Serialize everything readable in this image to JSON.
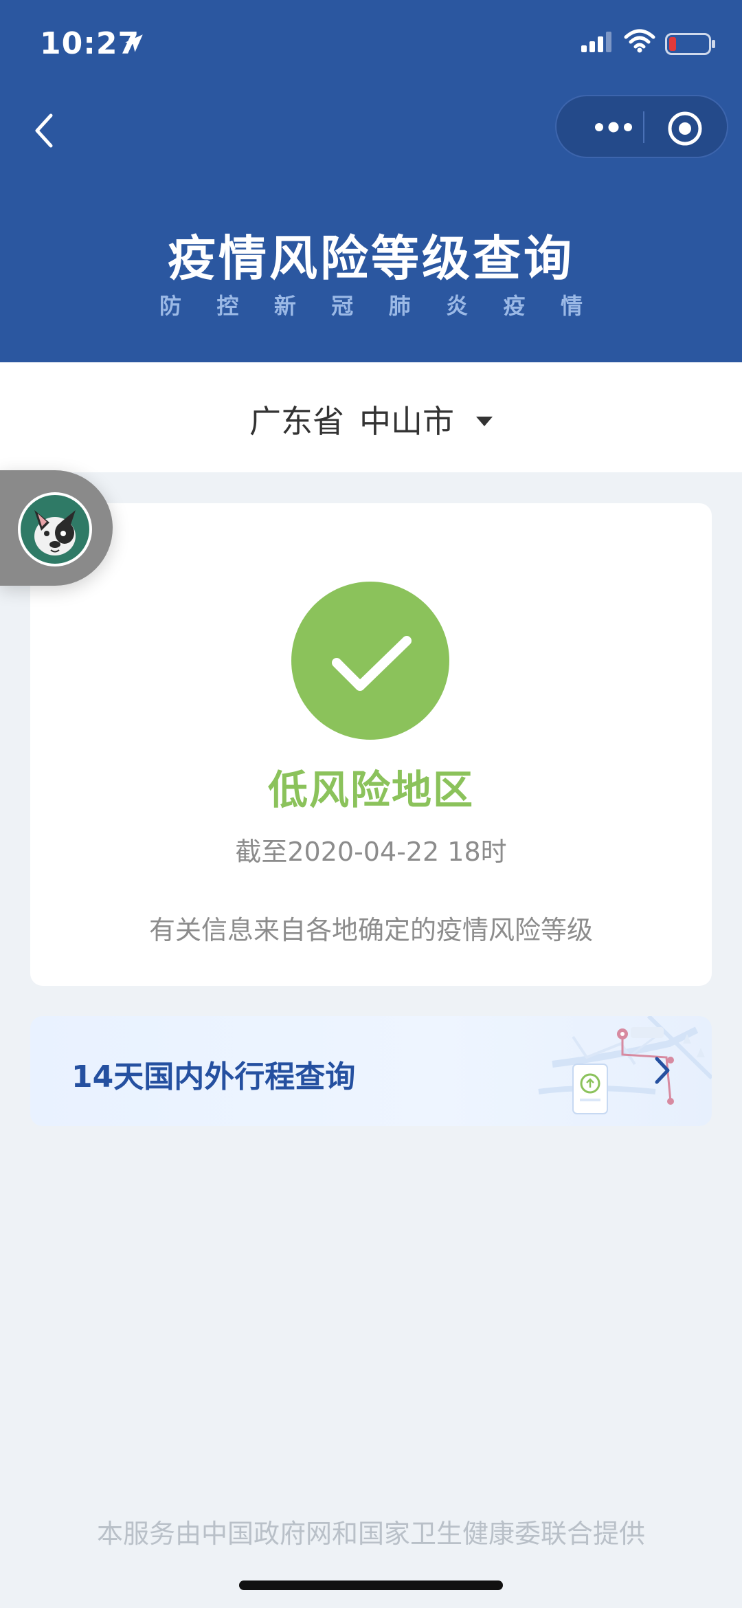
{
  "status_bar": {
    "time": "10:27"
  },
  "header": {
    "title": "疫情风险等级查询",
    "subtitle_chars": [
      "防",
      "控",
      "新",
      "冠",
      "肺",
      "炎",
      "疫",
      "情"
    ],
    "background_color": "#2b57a0"
  },
  "region": {
    "province": "广东省",
    "city": "中山市"
  },
  "risk_card": {
    "status": "低风险地区",
    "date": "截至2020-04-22 18时",
    "info": "有关信息来自各地确定的疫情风险等级",
    "status_color": "#8bc25b"
  },
  "trip_card": {
    "label": "14天国内外行程查询"
  },
  "footer": {
    "text": "本服务由中国政府网和国家卫生健康委联合提供"
  }
}
